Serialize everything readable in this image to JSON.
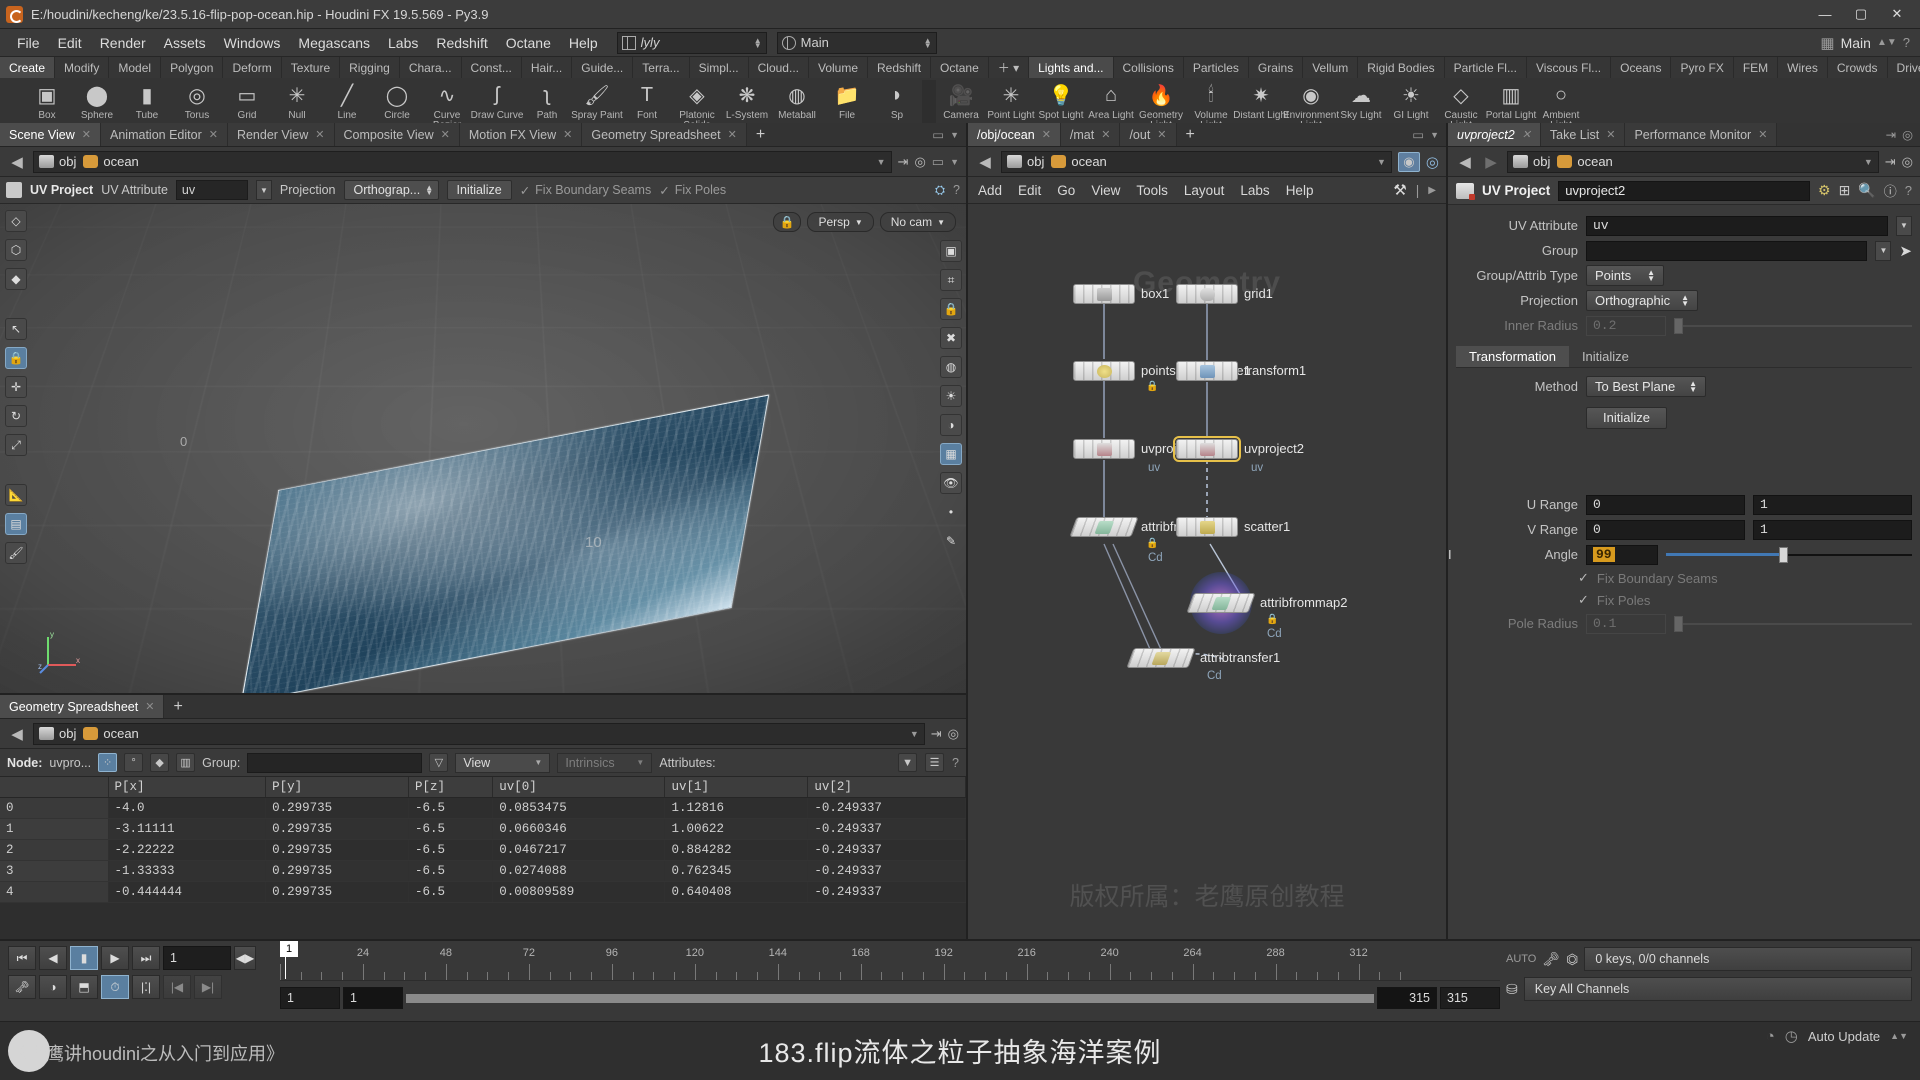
{
  "titlebar": {
    "title": "E:/houdini/kecheng/ke/23.5.16-flip-pop-ocean.hip - Houdini FX 19.5.569 - Py3.9",
    "minimize": "—",
    "maximize": "▢",
    "close": "✕"
  },
  "menubar": {
    "items": [
      "File",
      "Edit",
      "Render",
      "Assets",
      "Windows",
      "Megascans",
      "Labs",
      "Redshift",
      "Octane",
      "Help"
    ],
    "viewer_field": "lyly",
    "desktop_field": "Main",
    "desktop_label": "Main"
  },
  "shelf": {
    "tabs_left": [
      "Create",
      "Modify",
      "Model",
      "Polygon",
      "Deform",
      "Texture",
      "Rigging",
      "Chara...",
      "Const...",
      "Hair...",
      "Guide...",
      "Terra...",
      "Simpl...",
      "Cloud...",
      "Volume",
      "Redshift",
      "Octane"
    ],
    "active_left": "Create",
    "tabs_right": [
      "Lights and...",
      "Collisions",
      "Particles",
      "Grains",
      "Vellum",
      "Rigid Bodies",
      "Particle Fl...",
      "Viscous Fl...",
      "Oceans",
      "Pyro FX",
      "FEM",
      "Wires",
      "Crowds",
      "Drive Sim..."
    ],
    "active_right": "Lights and...",
    "tools_left": [
      {
        "label": "Box",
        "icon": "box-icon"
      },
      {
        "label": "Sphere",
        "icon": "sphere-icon"
      },
      {
        "label": "Tube",
        "icon": "tube-icon"
      },
      {
        "label": "Torus",
        "icon": "torus-icon"
      },
      {
        "label": "Grid",
        "icon": "grid-icon"
      },
      {
        "label": "Null",
        "icon": "null-icon"
      },
      {
        "label": "Line",
        "icon": "line-icon"
      },
      {
        "label": "Circle",
        "icon": "circle-icon"
      },
      {
        "label": "Curve Bezier",
        "icon": "curve-bezier-icon"
      },
      {
        "label": "Draw Curve",
        "icon": "draw-curve-icon"
      },
      {
        "label": "Path",
        "icon": "path-icon"
      },
      {
        "label": "Spray Paint",
        "icon": "spray-paint-icon"
      },
      {
        "label": "Font",
        "icon": "font-icon"
      },
      {
        "label": "Platonic Solids",
        "icon": "platonic-solids-icon"
      },
      {
        "label": "L-System",
        "icon": "lsystem-icon"
      },
      {
        "label": "Metaball",
        "icon": "metaball-icon"
      },
      {
        "label": "File",
        "icon": "file-icon"
      },
      {
        "label": "Sp",
        "icon": "spray-icon"
      }
    ],
    "tools_right": [
      {
        "label": "Camera",
        "icon": "camera-icon"
      },
      {
        "label": "Point Light",
        "icon": "point-light-icon"
      },
      {
        "label": "Spot Light",
        "icon": "spot-light-icon"
      },
      {
        "label": "Area Light",
        "icon": "area-light-icon"
      },
      {
        "label": "Geometry Light",
        "icon": "geometry-light-icon"
      },
      {
        "label": "Volume Light",
        "icon": "volume-light-icon"
      },
      {
        "label": "Distant Light",
        "icon": "distant-light-icon"
      },
      {
        "label": "Environment Light",
        "icon": "environment-light-icon"
      },
      {
        "label": "Sky Light",
        "icon": "sky-light-icon"
      },
      {
        "label": "GI Light",
        "icon": "gi-light-icon"
      },
      {
        "label": "Caustic Light",
        "icon": "caustic-light-icon"
      },
      {
        "label": "Portal Light",
        "icon": "portal-light-icon"
      },
      {
        "label": "Ambient Light",
        "icon": "ambient-light-icon"
      }
    ]
  },
  "left_pane": {
    "tabs": [
      "Scene View",
      "Animation Editor",
      "Render View",
      "Composite View",
      "Motion FX View",
      "Geometry Spreadsheet"
    ],
    "active_tab": "Scene View",
    "add_tab": "+",
    "path": {
      "obj": "obj",
      "geo": "ocean"
    },
    "viewport_toolbar": {
      "node_title": "UV Project",
      "attr_label": "UV Attribute",
      "attr_value": "uv",
      "projection_label": "Projection",
      "projection_value": "Orthograp...",
      "initialize": "Initialize",
      "fix_boundary": "Fix Boundary Seams",
      "fix_poles": "Fix Poles"
    },
    "viewport": {
      "persp": "Persp",
      "cam": "No cam",
      "axis_x": "x",
      "axis_y": "y",
      "axis_z": "z",
      "grid_num_1": "0",
      "grid_num_2": "10"
    }
  },
  "spreadsheet": {
    "tab": "Geometry Spreadsheet",
    "add_tab": "+",
    "path": {
      "obj": "obj",
      "geo": "ocean"
    },
    "node_label": "Node:",
    "node_value": "uvpro...",
    "group_label": "Group:",
    "group_value": "",
    "view_value": "View",
    "intrinsics": "Intrinsics",
    "attributes": "Attributes:",
    "columns": [
      "",
      "P[x]",
      "P[y]",
      "P[z]",
      "uv[0]",
      "uv[1]",
      "uv[2]"
    ],
    "rows": [
      [
        "0",
        "-4.0",
        "0.299735",
        "-6.5",
        "0.0853475",
        "1.12816",
        "-0.249337"
      ],
      [
        "1",
        "-3.11111",
        "0.299735",
        "-6.5",
        "0.0660346",
        "1.00622",
        "-0.249337"
      ],
      [
        "2",
        "-2.22222",
        "0.299735",
        "-6.5",
        "0.0467217",
        "0.884282",
        "-0.249337"
      ],
      [
        "3",
        "-1.33333",
        "0.299735",
        "-6.5",
        "0.0274088",
        "0.762345",
        "-0.249337"
      ],
      [
        "4",
        "-0.444444",
        "0.299735",
        "-6.5",
        "0.00809589",
        "0.640408",
        "-0.249337"
      ]
    ]
  },
  "network": {
    "tabs": [
      "/obj/ocean",
      "/mat",
      "/out"
    ],
    "active_tab": "/obj/ocean",
    "add_tab": "+",
    "path": {
      "obj": "obj",
      "geo": "ocean"
    },
    "menu": [
      "Add",
      "Edit",
      "Go",
      "View",
      "Tools",
      "Layout",
      "Labs",
      "Help"
    ],
    "watermark": "Geometry",
    "chinese_watermark": "版权所属：老鹰原创教程",
    "nodes": [
      {
        "name": "box1",
        "sub": "",
        "lock": false,
        "icon": "box-node-icon"
      },
      {
        "name": "grid1",
        "sub": "",
        "lock": false,
        "icon": "grid-node-icon"
      },
      {
        "name": "pointsfromvolume1",
        "sub": "",
        "lock": true,
        "icon": "points-node-icon"
      },
      {
        "name": "transform1",
        "sub": "",
        "lock": false,
        "icon": "transform-node-icon"
      },
      {
        "name": "uvproject1",
        "sub": "uv",
        "lock": false,
        "icon": "uvproject-node-icon"
      },
      {
        "name": "uvproject2",
        "sub": "uv",
        "lock": false,
        "icon": "uvproject-node-icon",
        "selected": true
      },
      {
        "name": "attribfrommap1",
        "sub": "Cd",
        "lock": true,
        "icon": "attribmap-node-icon"
      },
      {
        "name": "scatter1",
        "sub": "",
        "lock": false,
        "icon": "scatter-node-icon"
      },
      {
        "name": "attribfrommap2",
        "sub": "Cd",
        "lock": true,
        "icon": "attribmap-node-icon"
      },
      {
        "name": "attribtransfer1",
        "sub": "Cd",
        "lock": false,
        "icon": "attribtransfer-node-icon"
      }
    ]
  },
  "params": {
    "tabs": [
      "uvproject2",
      "Take List",
      "Performance Monitor"
    ],
    "active_tab": "uvproject2",
    "path": {
      "obj": "obj",
      "geo": "ocean"
    },
    "header_title": "UV Project",
    "header_name": "uvproject2",
    "rows": [
      {
        "label": "UV Attribute",
        "value": "uv",
        "type": "text-caret"
      },
      {
        "label": "Group",
        "value": "",
        "type": "text-caret-pick"
      },
      {
        "label": "Group/Attrib Type",
        "value": "Points",
        "type": "menu"
      },
      {
        "label": "Projection",
        "value": "Orthographic",
        "type": "menu"
      },
      {
        "label": "Inner Radius",
        "value": "0.2",
        "type": "slider-dim"
      }
    ],
    "inner_tabs": [
      "Transformation",
      "Initialize"
    ],
    "inner_active": "Transformation",
    "method_label": "Method",
    "method_value": "To Best Plane",
    "initialize_button": "Initialize",
    "u_range_label": "U Range",
    "u_range": [
      "0",
      "1"
    ],
    "v_range_label": "V Range",
    "v_range": [
      "0",
      "1"
    ],
    "angle_label": "Angle",
    "angle_value": "99",
    "fix_boundary": "Fix Boundary Seams",
    "fix_poles": "Fix Poles",
    "pole_radius_label": "Pole Radius",
    "pole_radius": "0.1"
  },
  "playbar": {
    "frame_current": "1",
    "range_start": "1",
    "range_end": "1",
    "global_start": "315",
    "global_end": "315",
    "ruler_ticks": [
      "24",
      "48",
      "72",
      "96",
      "120",
      "144",
      "168",
      "192",
      "216",
      "240",
      "264",
      "288",
      "312"
    ],
    "playhead_label": "1",
    "keys_status": "0 keys, 0/0 channels",
    "key_all_channels": "Key All Channels",
    "auto_update": "Auto Update",
    "auto_label": "AUTO"
  },
  "footer": {
    "title_cn": "183.flip流体之粒子抽象海洋案例",
    "watermark_cn": "《老鹰讲houdini之从入门到应用》"
  },
  "colors": {
    "accent_blue": "#4178b4",
    "selection_yellow": "#e7c14a",
    "orange_field": "#d79a1e",
    "panel_bg": "#3a3a3a"
  }
}
